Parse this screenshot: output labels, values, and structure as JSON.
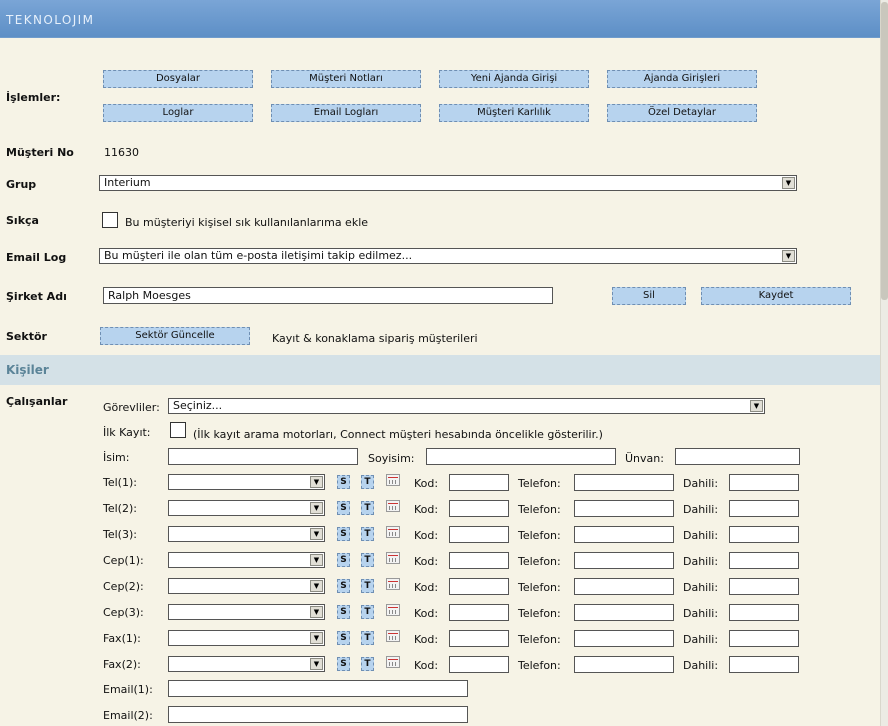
{
  "app": {
    "logo": "TEKNOLOJIM"
  },
  "islemler": {
    "label": "İşlemler:",
    "buttons_row1": [
      "Dosyalar",
      "Müşteri Notları",
      "Yeni Ajanda Girişi",
      "Ajanda Girişleri"
    ],
    "buttons_row2": [
      "Loglar",
      "Email Logları",
      "Müşteri Karlılık",
      "Özel Detaylar"
    ]
  },
  "musteri_no": {
    "label": "Müşteri No",
    "value": "11630"
  },
  "grup": {
    "label": "Grup",
    "value": "Interium"
  },
  "sikca": {
    "label": "Sıkça",
    "checkbox_label": "Bu müşteriyi kişisel sık kullanılanlarıma ekle"
  },
  "email_log": {
    "label": "Email Log",
    "value": "Bu müşteri ile olan tüm e-posta iletişimi takip edilmez..."
  },
  "sirket": {
    "label": "Şirket Adı",
    "value": "Ralph Moesges",
    "delete_label": "Sil",
    "save_label": "Kaydet"
  },
  "sektor": {
    "label": "Sektör",
    "button_label": "Sektör Güncelle",
    "value": "Kayıt & konaklama sipariş müşterileri"
  },
  "kisiler": {
    "title": "Kişiler"
  },
  "calisanlar": {
    "label": "Çalışanlar",
    "gorevliler_label": "Görevliler:",
    "gorevliler_value": "Seçiniz...",
    "ilk_kayit_label": "İlk Kayıt:",
    "ilk_kayit_note": "(İlk kayıt arama motorları, Connect müşteri hesabında öncelikle gösterilir.)",
    "isim_label": "İsim:",
    "soyisim_label": "Soyisim:",
    "unvan_label": "Ünvan:",
    "s_label": "S",
    "t_label": "T",
    "kod_label": "Kod:",
    "telefon_label": "Telefon:",
    "dahili_label": "Dahili:",
    "phones": [
      "Tel(1):",
      "Tel(2):",
      "Tel(3):",
      "Cep(1):",
      "Cep(2):",
      "Cep(3):",
      "Fax(1):",
      "Fax(2):"
    ],
    "emails": [
      "Email(1):",
      "Email(2):"
    ]
  }
}
